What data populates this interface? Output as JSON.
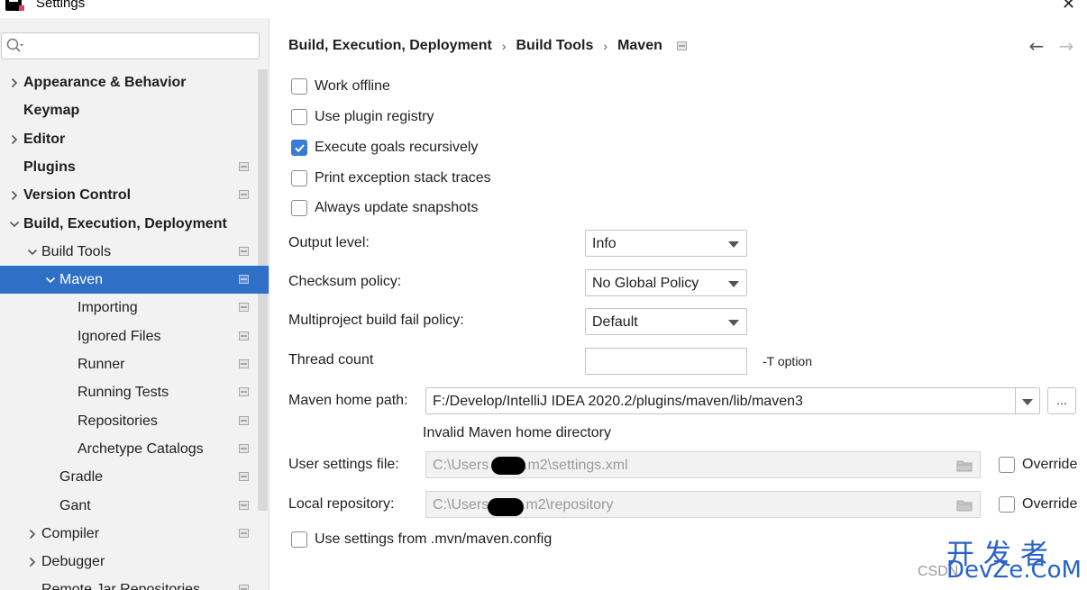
{
  "window": {
    "title": "Settings",
    "close_icon": "close-icon"
  },
  "search": {
    "placeholder": "",
    "value": ""
  },
  "sidebar": {
    "items": [
      {
        "label": "Appearance & Behavior",
        "level": 0,
        "bold": true,
        "chevron": "right",
        "page_icon": false
      },
      {
        "label": "Keymap",
        "level": 0,
        "bold": true,
        "chevron": "none",
        "page_icon": false
      },
      {
        "label": "Editor",
        "level": 0,
        "bold": true,
        "chevron": "right",
        "page_icon": false
      },
      {
        "label": "Plugins",
        "level": 0,
        "bold": true,
        "chevron": "none",
        "page_icon": true
      },
      {
        "label": "Version Control",
        "level": 0,
        "bold": true,
        "chevron": "right",
        "page_icon": true
      },
      {
        "label": "Build, Execution, Deployment",
        "level": 0,
        "bold": true,
        "chevron": "down",
        "page_icon": false
      },
      {
        "label": "Build Tools",
        "level": 1,
        "bold": false,
        "chevron": "down",
        "page_icon": true
      },
      {
        "label": "Maven",
        "level": 2,
        "bold": false,
        "chevron": "down",
        "page_icon": true,
        "selected": true
      },
      {
        "label": "Importing",
        "level": 3,
        "bold": false,
        "chevron": "none",
        "page_icon": true
      },
      {
        "label": "Ignored Files",
        "level": 3,
        "bold": false,
        "chevron": "none",
        "page_icon": true
      },
      {
        "label": "Runner",
        "level": 3,
        "bold": false,
        "chevron": "none",
        "page_icon": true
      },
      {
        "label": "Running Tests",
        "level": 3,
        "bold": false,
        "chevron": "none",
        "page_icon": true
      },
      {
        "label": "Repositories",
        "level": 3,
        "bold": false,
        "chevron": "none",
        "page_icon": true
      },
      {
        "label": "Archetype Catalogs",
        "level": 3,
        "bold": false,
        "chevron": "none",
        "page_icon": true
      },
      {
        "label": "Gradle",
        "level": 2,
        "bold": false,
        "chevron": "none",
        "page_icon": true
      },
      {
        "label": "Gant",
        "level": 2,
        "bold": false,
        "chevron": "none",
        "page_icon": true
      },
      {
        "label": "Compiler",
        "level": 1,
        "bold": false,
        "chevron": "right",
        "page_icon": true
      },
      {
        "label": "Debugger",
        "level": 1,
        "bold": false,
        "chevron": "right",
        "page_icon": false
      },
      {
        "label": "Remote Jar Repositories",
        "level": 1,
        "bold": false,
        "chevron": "none",
        "page_icon": true
      }
    ]
  },
  "breadcrumb": {
    "items": [
      "Build, Execution, Deployment",
      "Build Tools",
      "Maven"
    ],
    "separator": "›"
  },
  "nav": {
    "back": "←",
    "forward": "→"
  },
  "options": {
    "work_offline": {
      "label": "Work offline",
      "checked": false
    },
    "use_plugin_registry": {
      "label": "Use plugin registry",
      "checked": false
    },
    "execute_goals_recursively": {
      "label": "Execute goals recursively",
      "checked": true
    },
    "print_exception_stack_traces": {
      "label": "Print exception stack traces",
      "checked": false
    },
    "always_update_snapshots": {
      "label": "Always update snapshots",
      "checked": false
    },
    "use_settings_from_mvn": {
      "label": "Use settings from .mvn/maven.config",
      "checked": false
    }
  },
  "fields": {
    "output_level": {
      "label": "Output level:",
      "value": "Info"
    },
    "checksum_policy": {
      "label": "Checksum policy:",
      "value": "No Global Policy"
    },
    "multiproject_fail_policy": {
      "label": "Multiproject build fail policy:",
      "value": "Default"
    },
    "thread_count": {
      "label": "Thread count",
      "value": "",
      "hint": "-T option"
    },
    "maven_home": {
      "label": "Maven home path:",
      "value": "F:/Develop/IntelliJ IDEA 2020.2/plugins/maven/lib/maven3",
      "browse": "...",
      "error": "Invalid Maven home directory"
    },
    "user_settings": {
      "label": "User settings file:",
      "value_prefix": "C:\\Users",
      "value_suffix": ".m2\\settings.xml",
      "override_label": "Override",
      "override_checked": false
    },
    "local_repository": {
      "label": "Local repository:",
      "value_prefix": "C:\\Users",
      "value_suffix": ".m2\\repository",
      "override_label": "Override",
      "override_checked": false
    }
  },
  "watermark": {
    "cn": "开发者",
    "en": "DevZe.CoM",
    "csdn": "CSDN"
  },
  "colors": {
    "accent": "#2f6fc5",
    "checkbox_checked": "#3a7bd5",
    "sidebar_bg": "#f2f2f2",
    "watermark": "#2a62c8"
  }
}
